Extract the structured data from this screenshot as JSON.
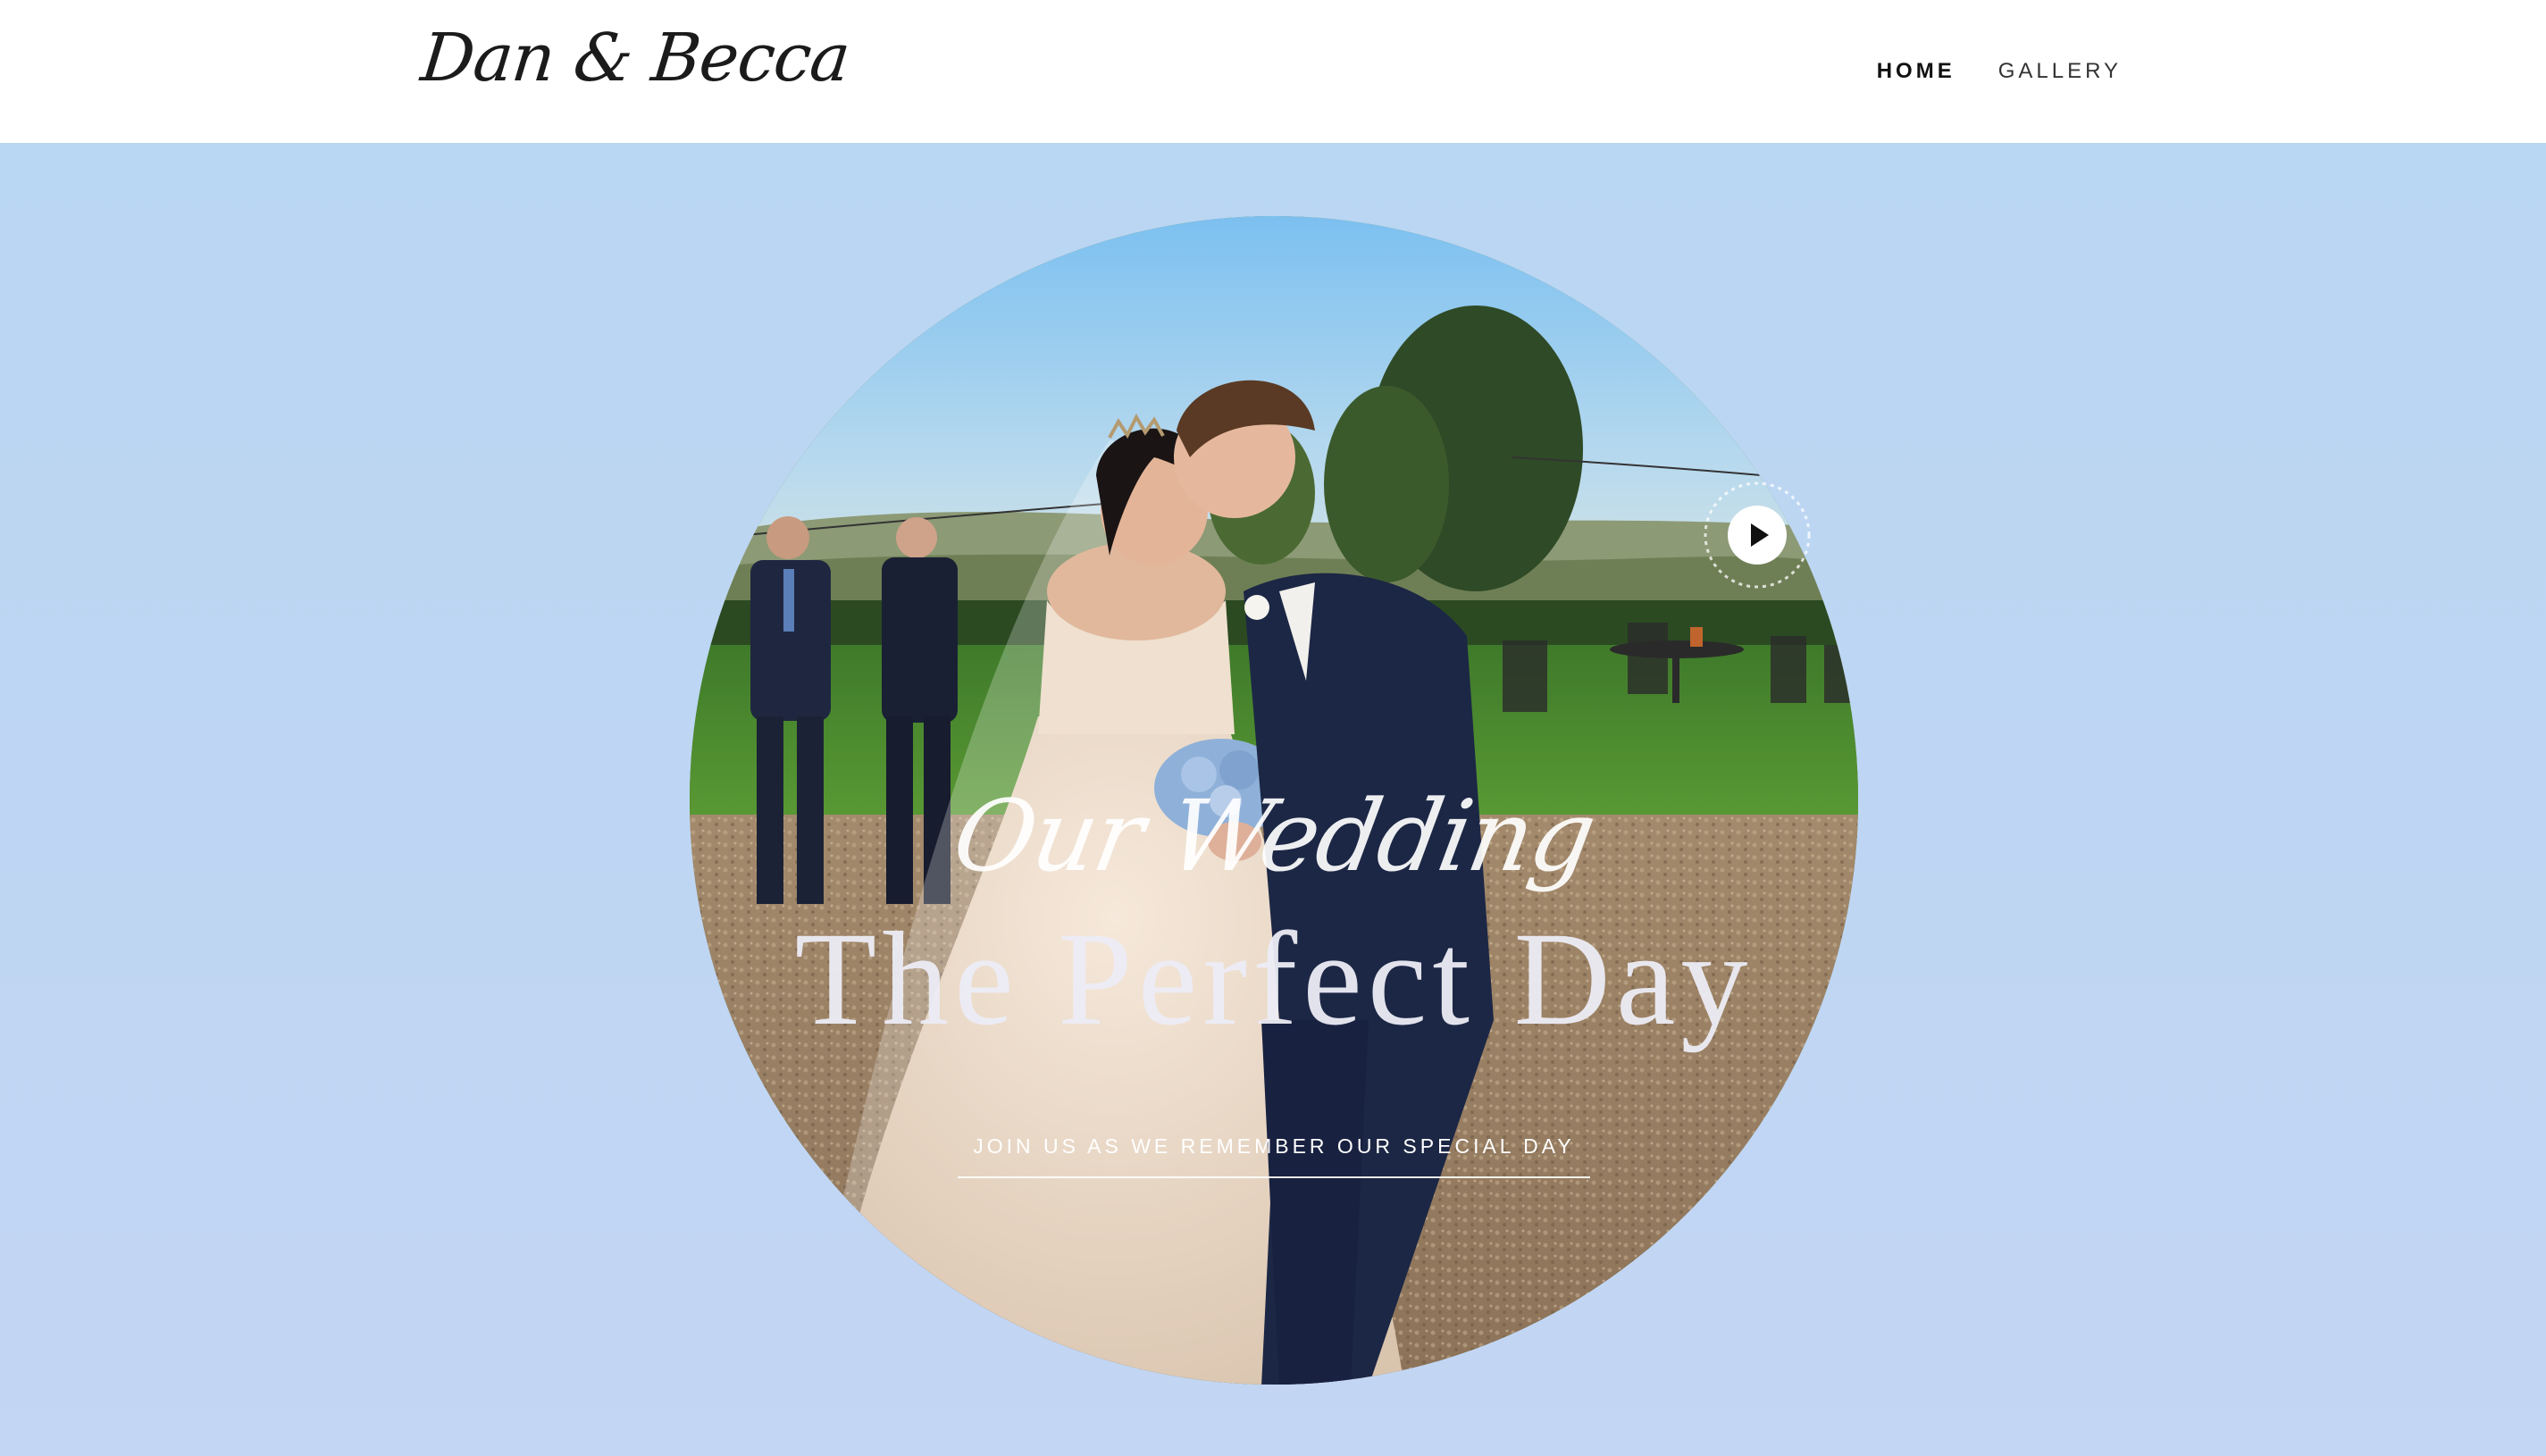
{
  "site": {
    "logo": "Dan & Becca"
  },
  "nav": {
    "items": [
      {
        "label": "HOME",
        "active": true
      },
      {
        "label": "GALLERY",
        "active": false
      }
    ]
  },
  "hero": {
    "script_title": "Our Wedding",
    "title": "The Perfect Day",
    "tagline": "JOIN US AS WE REMEMBER OUR SPECIAL DAY",
    "background_top": "#b9d6f2",
    "background_bottom": "#c3d6f4",
    "photo_alt": "Bride and groom kissing on a gravel terrace with guests and lawn behind",
    "play_icon": "play-icon"
  }
}
